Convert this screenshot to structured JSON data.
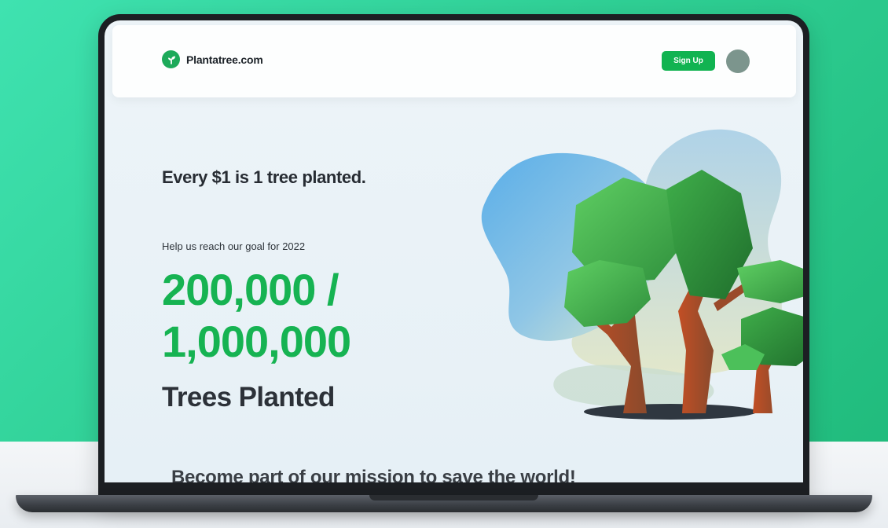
{
  "site": {
    "name": "Plantatree.com"
  },
  "navbar": {
    "signup_label": "Sign Up"
  },
  "hero": {
    "tagline": "Every $1 is 1 tree planted.",
    "goal_text": "Help us reach our goal for 2022",
    "count_line1": "200,000 /",
    "count_line2": "1,000,000",
    "count_label": "Trees Planted",
    "progress": 0.2
  },
  "mission": {
    "heading": "Become part of our mission to save the world!"
  },
  "colors": {
    "background": "#2fcf94",
    "accent": "#16b352",
    "text_dark": "#272c33",
    "avatar": "#7c958d"
  },
  "icons": {
    "logo": "leaf-logo-icon",
    "avatar": "user-avatar"
  }
}
